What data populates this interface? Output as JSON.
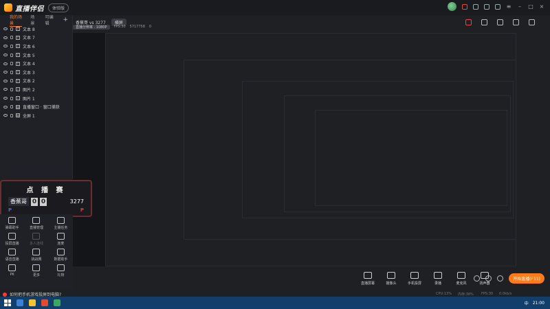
{
  "titlebar": {
    "logo_text": "直播伴侣",
    "version_badge": "体验版"
  },
  "sidebar": {
    "tabs": [
      "我的场景",
      "场景",
      "可编辑"
    ],
    "layers": [
      {
        "label": "文本 8",
        "type": "T"
      },
      {
        "label": "文本 7",
        "type": "T"
      },
      {
        "label": "文本 6",
        "type": "T"
      },
      {
        "label": "文本 5",
        "type": "T"
      },
      {
        "label": "文本 4",
        "type": "T"
      },
      {
        "label": "文本 3",
        "type": "T"
      },
      {
        "label": "文本 2",
        "type": "T"
      },
      {
        "label": "图片 2",
        "type": "I"
      },
      {
        "label": "图片 1",
        "type": "I"
      },
      {
        "label": "直播窗口 · 窗口捕获",
        "type": "W"
      },
      {
        "label": "全屏 1",
        "type": "W"
      }
    ]
  },
  "topbar": {
    "title": "香蕉哥 vs 3277",
    "edit_label": "横屏",
    "resolution": "直播分辨率 · 1080P",
    "fps": "FPS:30",
    "bitrate": "5717758",
    "count": "0"
  },
  "scoreboard": {
    "title": "点 播 赛",
    "player1": "香蕉哥",
    "digit1": "0",
    "digit2": "0",
    "player2_score": "3277",
    "p1_mark": "P",
    "p2_mark": "P"
  },
  "tools": [
    {
      "label": "弹幕助手"
    },
    {
      "label": "直播管理"
    },
    {
      "label": "主播任务"
    },
    {
      "label": "投屏直播"
    },
    {
      "label": "多人连线",
      "dim": true
    },
    {
      "label": "连麦"
    },
    {
      "label": "语音直播"
    },
    {
      "label": "挑战赛"
    },
    {
      "label": "数据助手"
    },
    {
      "label": "PK"
    },
    {
      "label": "更多"
    },
    {
      "label": "礼物"
    }
  ],
  "bottom_tools": [
    {
      "label": "直播屏幕"
    },
    {
      "label": "摄像头"
    },
    {
      "label": "手机投屏"
    },
    {
      "label": "录播"
    },
    {
      "label": "麦克风"
    },
    {
      "label": "扬声器"
    }
  ],
  "start_button": "开始直播(F11)",
  "status": {
    "cpu": "CPU:13%",
    "mem": "内存:38%",
    "fps": "FPS:30",
    "net": "0.0kb/s"
  },
  "promo": "如何把手机游戏投屏到电脑?",
  "taskbar": {
    "time": "21:00",
    "lang": "中"
  },
  "colors": {
    "accent": "#ff7a1a",
    "panel": "#202126",
    "taskbar": "#123e6b"
  }
}
